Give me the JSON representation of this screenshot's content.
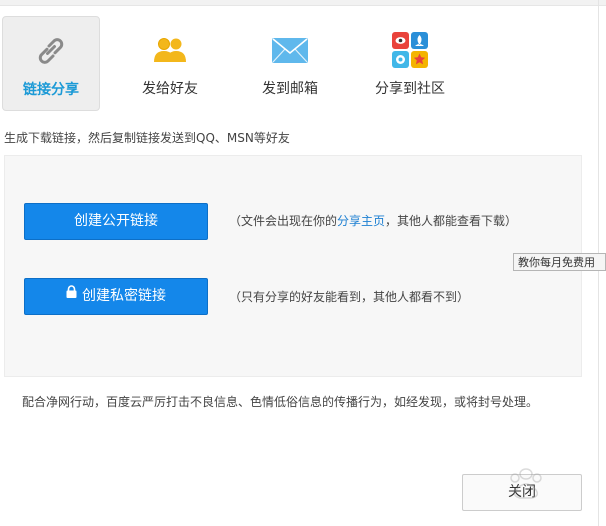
{
  "tabs": [
    {
      "label": "链接分享",
      "icon": "link-icon",
      "active": true
    },
    {
      "label": "发给好友",
      "icon": "friends-icon",
      "active": false
    },
    {
      "label": "发到邮箱",
      "icon": "email-icon",
      "active": false
    },
    {
      "label": "分享到社区",
      "icon": "community-icon",
      "active": false
    }
  ],
  "description": "生成下载链接，然后复制链接发送到QQ、MSN等好友",
  "public_link": {
    "button_label": "创建公开链接",
    "note_prefix": "（文件会出现在你的",
    "note_link": "分享主页",
    "note_suffix": "，其他人都能查看下载）"
  },
  "private_link": {
    "button_label": "创建私密链接",
    "note": "（只有分享的好友能看到，其他人都看不到）"
  },
  "tooltip": "教你每月免费用",
  "footer_text": "配合净网行动，百度云严厉打击不良信息、色情低俗信息的传播行为，如经发现，或将封号处理。",
  "close_label": "关闭",
  "colors": {
    "accent": "#1c9ad6",
    "button_blue": "#1487ea",
    "link_blue": "#1c7fd2",
    "friends_yellow": "#f3b71b",
    "email_blue": "#5fb8ec"
  }
}
